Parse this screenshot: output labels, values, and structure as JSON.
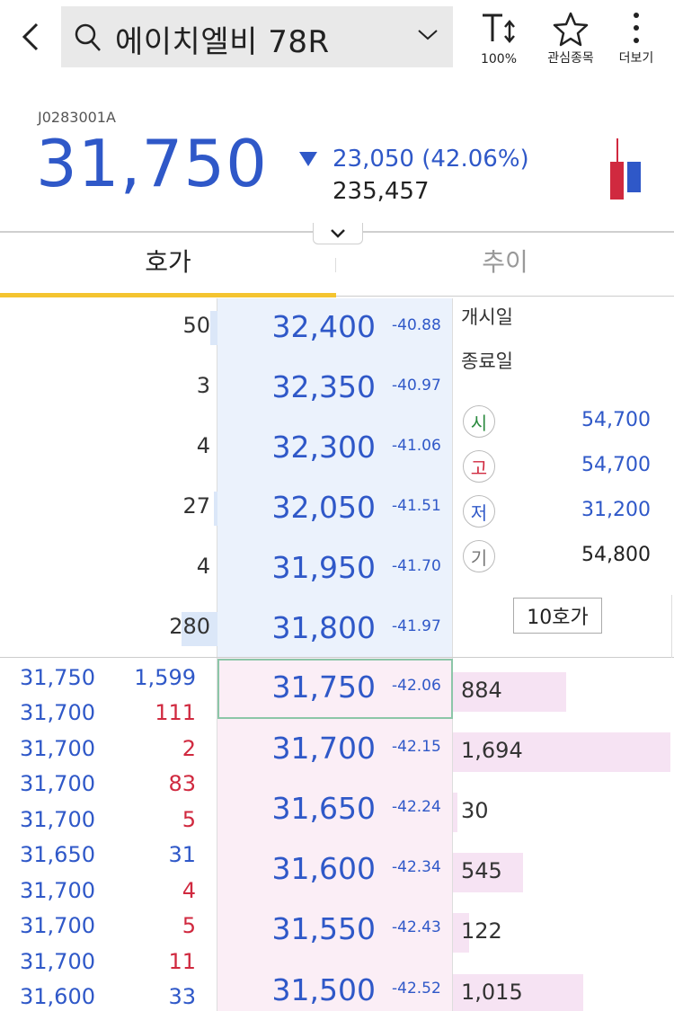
{
  "header": {
    "search_title": "에이치엘비 78R",
    "font_size_label": "100%",
    "watchlist_label": "관심종목",
    "more_label": "더보기"
  },
  "quote": {
    "code": "J0283001A",
    "price": "31,750",
    "change": "23,050 (42.06%)",
    "volume": "235,457",
    "direction": "down"
  },
  "tabs": {
    "orderbook": "호가",
    "trend": "추이"
  },
  "asks": [
    {
      "qty": "50",
      "price": "32,400",
      "pct": "-40.88"
    },
    {
      "qty": "3",
      "price": "32,350",
      "pct": "-40.97"
    },
    {
      "qty": "4",
      "price": "32,300",
      "pct": "-41.06"
    },
    {
      "qty": "27",
      "price": "32,050",
      "pct": "-41.51"
    },
    {
      "qty": "4",
      "price": "31,950",
      "pct": "-41.70"
    },
    {
      "qty": "280",
      "price": "31,800",
      "pct": "-41.97"
    }
  ],
  "bids": [
    {
      "price": "31,750",
      "pct": "-42.06",
      "qty": "884"
    },
    {
      "price": "31,700",
      "pct": "-42.15",
      "qty": "1,694"
    },
    {
      "price": "31,650",
      "pct": "-42.24",
      "qty": "30"
    },
    {
      "price": "31,600",
      "pct": "-42.34",
      "qty": "545"
    },
    {
      "price": "31,550",
      "pct": "-42.43",
      "qty": "122"
    },
    {
      "price": "31,500",
      "pct": "-42.52",
      "qty": "1,015"
    }
  ],
  "ticks": [
    {
      "price": "31,750",
      "qty": "1,599",
      "side": "sell"
    },
    {
      "price": "31,700",
      "qty": "111",
      "side": "buy"
    },
    {
      "price": "31,700",
      "qty": "2",
      "side": "buy"
    },
    {
      "price": "31,700",
      "qty": "83",
      "side": "buy"
    },
    {
      "price": "31,700",
      "qty": "5",
      "side": "buy"
    },
    {
      "price": "31,650",
      "qty": "31",
      "side": "sell"
    },
    {
      "price": "31,700",
      "qty": "4",
      "side": "buy"
    },
    {
      "price": "31,700",
      "qty": "5",
      "side": "buy"
    },
    {
      "price": "31,700",
      "qty": "11",
      "side": "buy"
    },
    {
      "price": "31,600",
      "qty": "33",
      "side": "sell"
    }
  ],
  "info": {
    "listing_date_label": "개시일",
    "expiry_date_label": "종료일",
    "open_label": "시",
    "open_value": "54,700",
    "high_label": "고",
    "high_value": "54,700",
    "low_label": "저",
    "low_value": "31,200",
    "base_label": "기",
    "base_value": "54,800",
    "ten_levels_button": "10호가"
  },
  "colors": {
    "down_blue": "#2f58c8",
    "up_red": "#d0293f",
    "tab_accent": "#f4c430",
    "ask_bg": "#ebf2fc",
    "bid_bg": "#fbeef6"
  }
}
